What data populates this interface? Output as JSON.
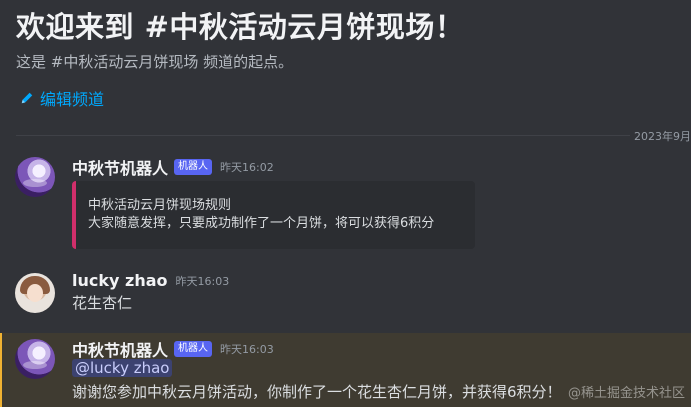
{
  "welcome": {
    "title": "欢迎来到 #中秋活动云月饼现场！",
    "subtitle": "这是 #中秋活动云月饼现场 频道的起点。",
    "edit_label": "编辑频道"
  },
  "divider": {
    "date": "2023年9月"
  },
  "messages": [
    {
      "author": "中秋节机器人",
      "bot_tag": "机器人",
      "time": "昨天16:02",
      "embed": {
        "line1": "中秋活动云月饼现场规则",
        "line2": "大家随意发挥，只要成功制作了一个月饼，将可以获得6积分"
      }
    },
    {
      "author": "lucky zhao",
      "time": "昨天16:03",
      "text": "花生杏仁"
    },
    {
      "author": "中秋节机器人",
      "bot_tag": "机器人",
      "time": "昨天16:03",
      "mention": "@lucky zhao",
      "text": "谢谢您参加中秋云月饼活动，你制作了一个花生杏仁月饼，并获得6积分！"
    }
  ],
  "watermark": "@稀土掘金技术社区",
  "colors": {
    "background": "#313338",
    "link": "#00a8fc",
    "bot_tag": "#5865f2",
    "embed_border": "#d12f6b",
    "mention_highlight": "#f0b232"
  }
}
